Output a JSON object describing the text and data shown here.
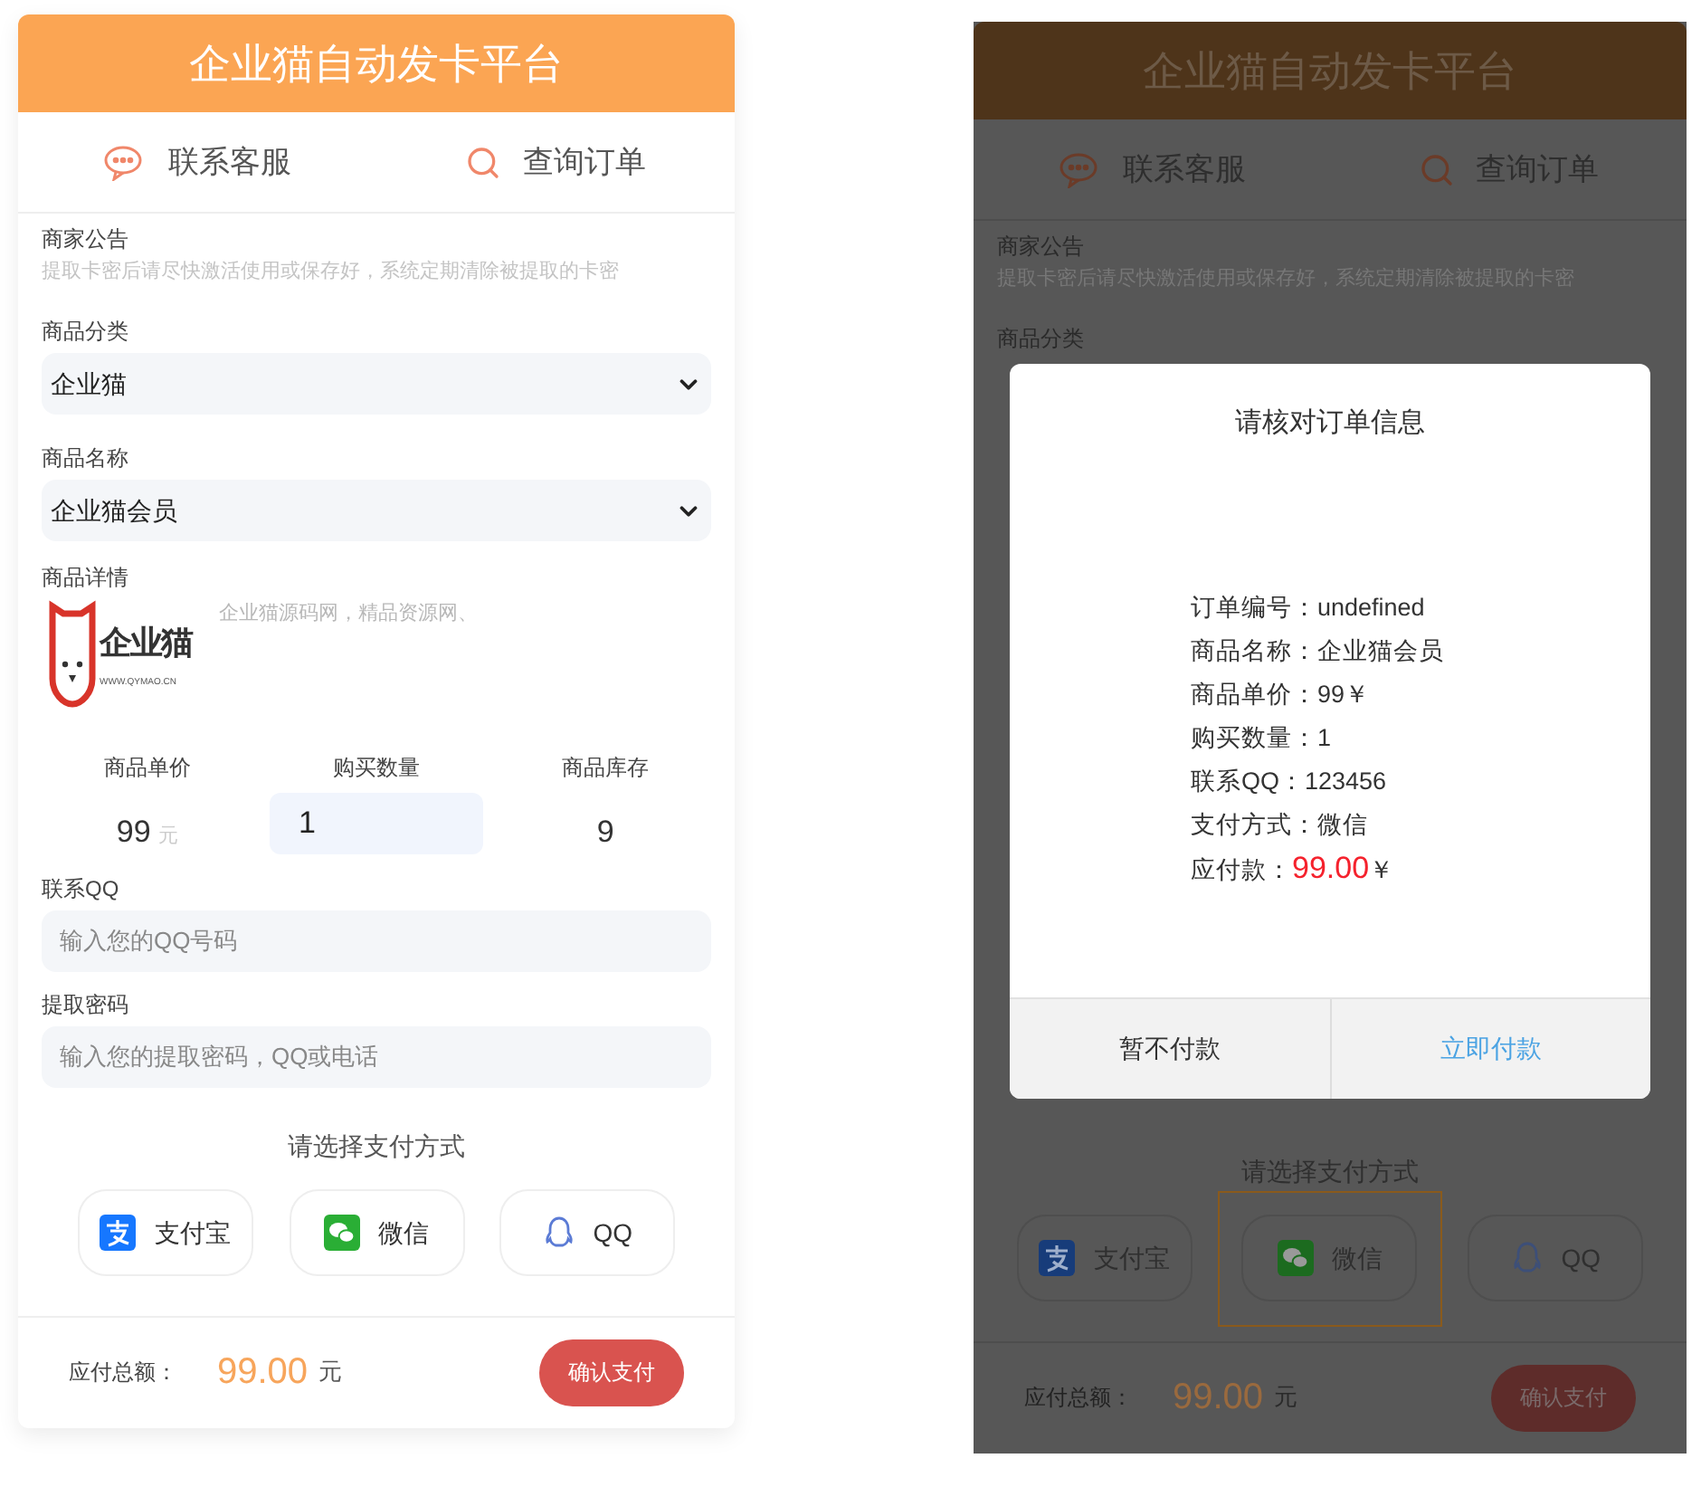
{
  "order_page": {
    "header_title": "企业猫自动发卡平台",
    "nav": [
      {
        "kind": "chat",
        "label": "联系客服"
      },
      {
        "kind": "search",
        "label": "查询订单"
      }
    ],
    "notice_label": "商家公告",
    "notice_text": "提取卡密后请尽快激活使用或保存好，系统定期清除被提取的卡密",
    "category_label": "商品分类",
    "category_value": "企业猫",
    "product_label": "商品名称",
    "product_value": "企业猫会员",
    "detail_label": "商品详情",
    "logo_text": "企业猫",
    "logo_caption": "WWW.QYMAO.CN",
    "detail_text": "企业猫源码网，精品资源网、",
    "stats": [
      {
        "kind": "price",
        "label": "商品单价",
        "value": "99",
        "unit": "元"
      },
      {
        "kind": "quantity",
        "label": "购买数量",
        "value": "1"
      },
      {
        "kind": "stock",
        "label": "商品库存",
        "value": "9"
      }
    ],
    "fields": [
      {
        "label": "联系QQ",
        "placeholder": "输入您的QQ号码"
      },
      {
        "label": "提取密码",
        "placeholder": "输入您的提取密码，QQ或电话"
      }
    ],
    "payment_prompt": "请选择支付方式",
    "payment_methods": [
      {
        "kind": "alipay",
        "label": "支付宝",
        "selected": false
      },
      {
        "kind": "wechat",
        "label": "微信",
        "selected": false
      },
      {
        "kind": "qq",
        "label": "QQ",
        "selected": false
      }
    ],
    "footer": {
      "label": "应付总额：",
      "amount": "99.00",
      "unit": "元",
      "button": "确认支付"
    }
  },
  "confirm_screen": {
    "header_title": "企业猫自动发卡平台",
    "nav": [
      {
        "kind": "chat",
        "label": "联系客服"
      },
      {
        "kind": "search",
        "label": "查询订单"
      }
    ],
    "notice_label": "商家公告",
    "notice_text": "提取卡密后请尽快激活使用或保存好，系统定期清除被提取的卡密",
    "category_label": "商品分类",
    "dialog": {
      "title": "请核对订单信息",
      "lines": [
        "订单编号：undefined",
        "商品名称：企业猫会员",
        "商品单价：99￥",
        "购买数量：1",
        "联系QQ：123456",
        "支付方式：微信"
      ],
      "amount_label": "应付款：",
      "amount": "99.00",
      "currency": "￥",
      "buttons": [
        {
          "kind": "cancel",
          "label": "暂不付款"
        },
        {
          "kind": "confirm",
          "label": "立即付款"
        }
      ]
    },
    "payment_prompt": "请选择支付方式",
    "payment_methods": [
      {
        "kind": "alipay",
        "label": "支付宝",
        "selected": false
      },
      {
        "kind": "wechat",
        "label": "微信",
        "selected": true
      },
      {
        "kind": "qq",
        "label": "QQ",
        "selected": false
      }
    ],
    "footer": {
      "label": "应付总额：",
      "amount": "99.00",
      "unit": "元",
      "button": "确认支付"
    }
  }
}
